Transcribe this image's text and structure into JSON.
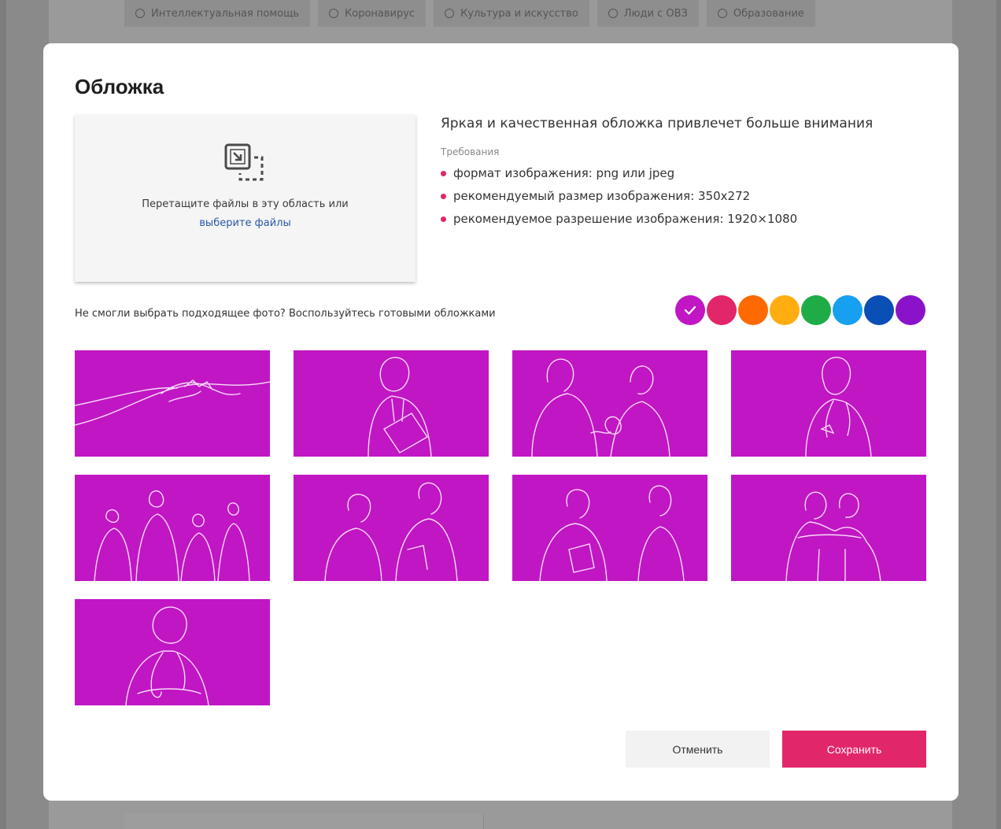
{
  "background": {
    "category_tags": [
      "Интеллектуальная помощь",
      "Коронавирус",
      "Культура и искусство",
      "Люди с ОВЗ",
      "Образование"
    ]
  },
  "modal": {
    "title": "Обложка",
    "dropzone": {
      "text": "Перетащите файлы в эту область или",
      "link": "выберите файлы"
    },
    "info": {
      "headline": "Яркая и качественная обложка привлечет больше внимания",
      "requirements_label": "Требования",
      "requirements": [
        "формат изображения: png или jpeg",
        "рекомендуемый размер изображения: 350x272",
        "рекомендуемое разрешение изображения: 1920×1080"
      ]
    },
    "ready_covers_text": "Не смогли выбрать подходящее фото? Воспользуйтесь готовыми обложками",
    "color_options": [
      {
        "color": "#c116c4",
        "selected": true
      },
      {
        "color": "#e2266a",
        "selected": false
      },
      {
        "color": "#ff6a00",
        "selected": false
      },
      {
        "color": "#ffad10",
        "selected": false
      },
      {
        "color": "#1fac47",
        "selected": false
      },
      {
        "color": "#18a0f0",
        "selected": false
      },
      {
        "color": "#0a4fb5",
        "selected": false
      },
      {
        "color": "#8a12c8",
        "selected": false
      }
    ],
    "cover_color": "#c116c4",
    "covers": [
      {
        "icon": "handshake-illustration"
      },
      {
        "icon": "doctor-with-clipboard-illustration"
      },
      {
        "icon": "doctor-with-family-illustration"
      },
      {
        "icon": "nurse-illustration"
      },
      {
        "icon": "medical-team-illustration"
      },
      {
        "icon": "doctor-with-patient-illustration"
      },
      {
        "icon": "doctor-consultation-illustration"
      },
      {
        "icon": "embracing-people-illustration"
      },
      {
        "icon": "doctor-portrait-illustration"
      }
    ],
    "buttons": {
      "cancel": "Отменить",
      "save": "Сохранить"
    }
  }
}
